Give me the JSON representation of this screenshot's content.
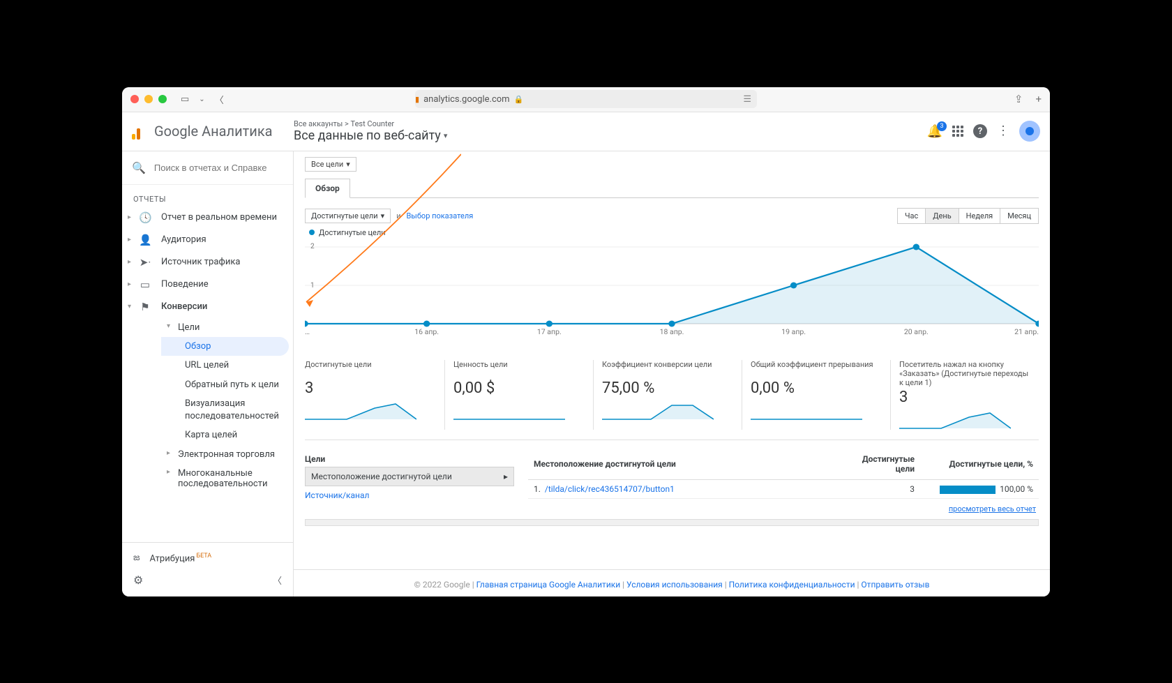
{
  "browser": {
    "url": "analytics.google.com"
  },
  "header": {
    "product": "Google Аналитика",
    "breadcrumb": "Все аккаунты > Test Counter",
    "view": "Все данные по веб-сайту",
    "notifications": "3"
  },
  "sidebar": {
    "search_placeholder": "Поиск в отчетах и Справке",
    "section_label": "ОТЧЕТЫ",
    "items": {
      "realtime": "Отчет в реальном времени",
      "audience": "Аудитория",
      "acquisition": "Источник трафика",
      "behavior": "Поведение",
      "conversions": "Конверсии"
    },
    "goals": {
      "label": "Цели",
      "overview": "Обзор",
      "url": "URL целей",
      "reverse": "Обратный путь к цели",
      "funnel": "Визуализация последовательностей",
      "flow": "Карта целей"
    },
    "ecommerce": "Электронная торговля",
    "multichannel": "Многоканальные последовательности",
    "attribution": "Атрибуция",
    "beta": "БЕТА"
  },
  "main": {
    "goal_filter": "Все цели",
    "tab": "Обзор",
    "metric_sel": "Достигнутые цели",
    "compare_conj": "и",
    "compare_link": "Выбор показателя",
    "periods": {
      "hour": "Час",
      "day": "День",
      "week": "Неделя",
      "month": "Месяц"
    },
    "legend": "Достигнутые цели",
    "cards": [
      {
        "label": "Достигнутые цели",
        "value": "3"
      },
      {
        "label": "Ценность цели",
        "value": "0,00 $"
      },
      {
        "label": "Коэффициент конверсии цели",
        "value": "75,00 %"
      },
      {
        "label": "Общий коэффициент прерывания",
        "value": "0,00 %"
      },
      {
        "label": "Посетитель нажал на кнопку «Заказать» (Достигнутые переходы к цели 1)",
        "value": "3"
      }
    ],
    "dim": {
      "header": "Цели",
      "active": "Местоположение достигнутой цели",
      "source": "Источник/канал"
    },
    "table": {
      "col_loc": "Местоположение достигнутой цели",
      "col_goals": "Достигнутые цели",
      "col_pct": "Достигнутые цели, %",
      "row": {
        "idx": "1.",
        "loc": "/tilda/click/rec436514707/button1",
        "goals": "3",
        "pct": "100,00 %"
      }
    },
    "view_full": "просмотреть весь отчет"
  },
  "chart_data": {
    "type": "line",
    "x": [
      "…",
      "16 апр.",
      "17 апр.",
      "18 апр.",
      "19 апр.",
      "20 апр.",
      "21 апр."
    ],
    "values": [
      0,
      0,
      0,
      0,
      1,
      2,
      0
    ],
    "ylabel": "",
    "ylim": [
      0,
      2
    ],
    "yticks": [
      1,
      2
    ],
    "series_name": "Достигнутые цели"
  },
  "footer": {
    "copyright": "© 2022 Google",
    "links": {
      "home": "Главная страница Google Аналитики",
      "terms": "Условия использования",
      "privacy": "Политика конфиденциальности",
      "feedback": "Отправить отзыв"
    }
  }
}
